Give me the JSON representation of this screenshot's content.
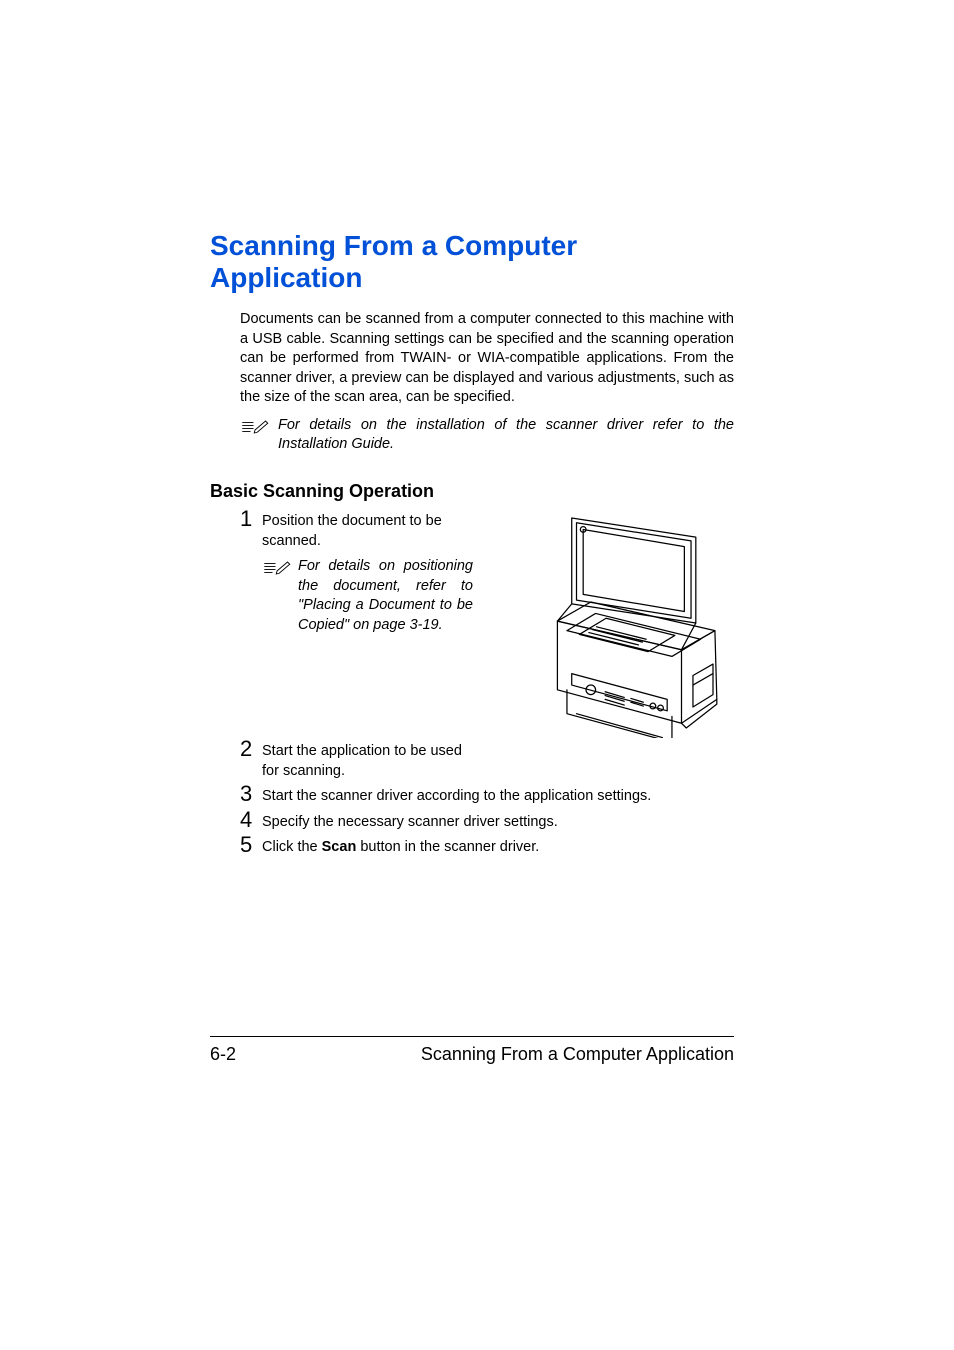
{
  "title": "Scanning From a Computer Application",
  "intro": "Documents can be scanned from a computer connected to this machine with a USB cable. Scanning settings can be specified and the scanning operation can be performed from TWAIN- or WIA-compatible applications. From the scanner driver, a preview can be displayed and various adjustments, such as the size of the scan area, can be specified.",
  "note1": "For details on the installation of the scanner driver refer to the Installation Guide.",
  "subhead": "Basic Scanning Operation",
  "steps": {
    "s1": {
      "num": "1",
      "text": "Position the document to be scanned."
    },
    "s1_note": "For details on positioning the document, refer to \"Placing a Document to be Copied\" on page 3-19.",
    "s2": {
      "num": "2",
      "text": "Start the application to be used for scanning."
    },
    "s3": {
      "num": "3",
      "text": "Start the scanner driver according to the application settings."
    },
    "s4": {
      "num": "4",
      "text": "Specify the necessary scanner driver settings."
    },
    "s5": {
      "num": "5",
      "text_before": "Click the ",
      "bold": "Scan",
      "text_after": " button in the scanner driver."
    }
  },
  "footer": {
    "page": "6-2",
    "title": "Scanning From a Computer Application"
  }
}
